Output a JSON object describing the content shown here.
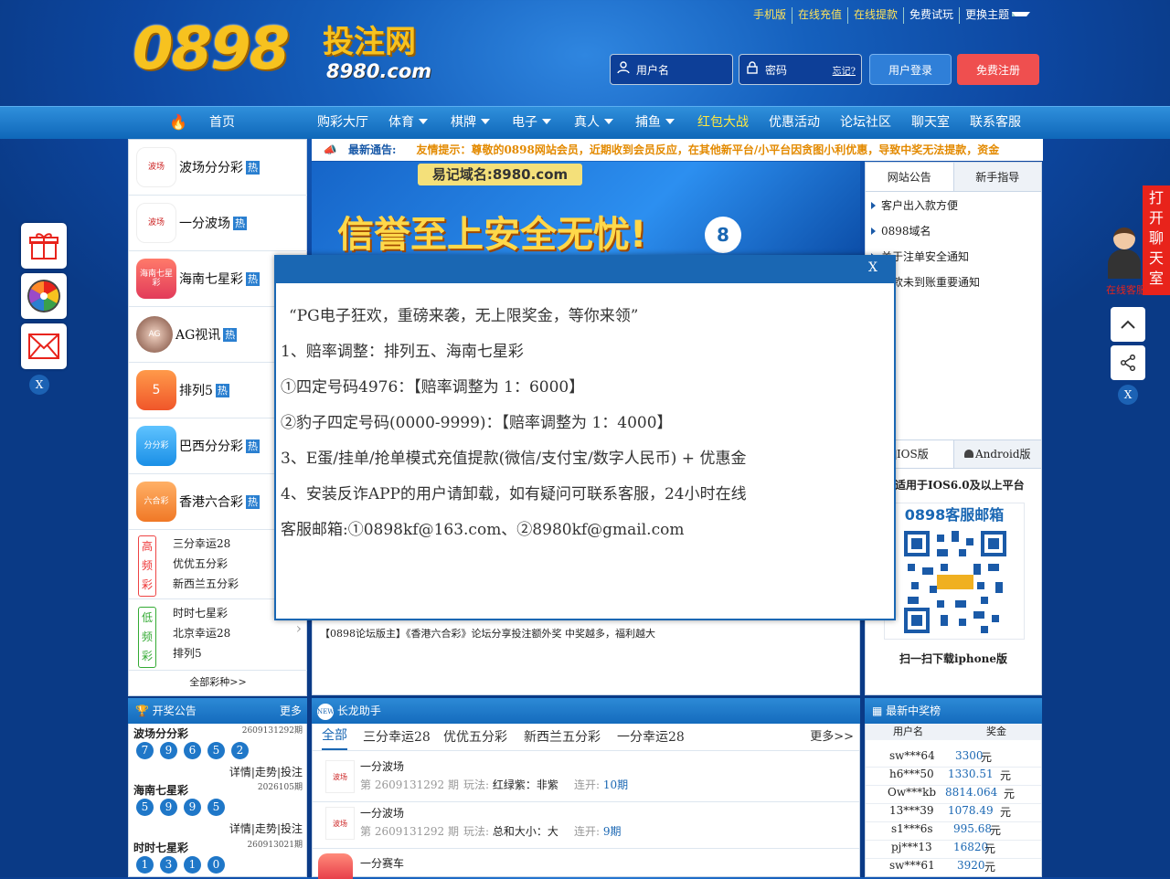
{
  "logo": {
    "main": "0898",
    "cn": "投注网",
    "domain": "8980.com"
  },
  "top_links": [
    "手机版",
    "在线充值",
    "在线提款",
    "免费试玩",
    "更换主题"
  ],
  "login": {
    "user_placeholder": "用户名",
    "pass_placeholder": "密码",
    "forgot": "忘记?",
    "login_btn": "用户登录",
    "register_btn": "免费注册"
  },
  "nav": {
    "home": "首页",
    "items": [
      "购彩大厅",
      "体育",
      "棋牌",
      "电子",
      "真人",
      "捕鱼",
      "红包大战",
      "优惠活动",
      "论坛社区",
      "聊天室",
      "联系客服"
    ]
  },
  "left_games": [
    {
      "name": "波场分分彩",
      "icon": "波场",
      "hot": "热"
    },
    {
      "name": "一分波场",
      "icon": "波场",
      "hot": "热"
    },
    {
      "name": "海南七星彩",
      "icon": "海南七星彩",
      "hot": "热"
    },
    {
      "name": "AG视讯",
      "icon": "AG",
      "hot": "热"
    },
    {
      "name": "排列5",
      "icon": "5",
      "hot": "热"
    },
    {
      "name": "巴西分分彩",
      "icon": "分分彩",
      "hot": "热"
    },
    {
      "name": "香港六合彩",
      "icon": "六合彩",
      "hot": "热"
    }
  ],
  "freq_high": {
    "tag": "高频彩",
    "items": [
      "三分幸运28",
      "优优五分彩",
      "新西兰五分彩"
    ]
  },
  "freq_low": {
    "tag": "低频彩",
    "items": [
      "时时七星彩",
      "北京幸运28",
      "排列5"
    ]
  },
  "all_games": "全部彩种>>",
  "notice": {
    "label": "最新通告:",
    "text": "友情提示：尊敬的0898网站会员，近期收到会员反应，在其他新平台/小平台因贪图小利优惠，导致中奖无法提款，资金"
  },
  "banner": {
    "domain": "易记域名:8980.com",
    "slogan": "信誉至上安全无忧!"
  },
  "right_tabs": [
    "网站公告",
    "新手指导"
  ],
  "right_list": [
    "客户出入款方便",
    "0898域名",
    "关于注单安全通知",
    "提款未到账重要通知"
  ],
  "app_tabs": [
    "IOS版",
    "Android版"
  ],
  "app_note": "适用于IOS6.0及以上平台",
  "qr_title": "0898客服邮箱",
  "qr_caption": "扫一扫下载iphone版",
  "forum_line": "【0898论坛版主】《香港六合彩》论坛分享投注额外奖 中奖越多，福利越大",
  "modal": {
    "close": "X",
    "lines": [
      "“PG电子狂欢，重磅来袭，无上限奖金，等你来领”",
      "1、赔率调整：排列五、海南七星彩",
      "①四定号码4976：【赔率调整为 1：6000】",
      "②豹子四定号码(0000-9999)：【赔率调整为 1：4000】",
      "3、E蛋/挂单/抢单模式充值提款(微信/支付宝/数字人民币) + 优惠金",
      "4、安装反诈APP的用户请卸载，如有疑问可联系客服，24小时在线",
      "客服邮箱:①0898kf@163.com、②8980kf@gmail.com"
    ]
  },
  "draws": {
    "title": "开奖公告",
    "more": "更多",
    "items": [
      {
        "name": "波场分分彩",
        "issue": "2609131292期",
        "balls": [
          "7",
          "9",
          "6",
          "5",
          "2"
        ],
        "links": "详情|走势|投注"
      },
      {
        "name": "海南七星彩",
        "issue": "2026105期",
        "balls": [
          "5",
          "9",
          "9",
          "5"
        ],
        "links": "详情|走势|投注"
      },
      {
        "name": "时时七星彩",
        "issue": "260913021期",
        "balls": [
          "1",
          "3",
          "1",
          "0"
        ],
        "links": ""
      }
    ]
  },
  "dragon": {
    "title": "长龙助手",
    "tabs": [
      "全部",
      "三分幸运28",
      "优优五分彩",
      "新西兰五分彩",
      "一分幸运28"
    ],
    "more": "更多>>",
    "rows": [
      {
        "game": "一分波场",
        "issue": "第 2609131292 期",
        "play_label": "玩法:",
        "play": "红绿紫：",
        "val": "非紫",
        "streak_label": "连开:",
        "streak": "10期"
      },
      {
        "game": "一分波场",
        "issue": "第 2609131292 期",
        "play_label": "玩法:",
        "play": "总和大小：",
        "val": "大",
        "streak_label": "连开:",
        "streak": "9期"
      },
      {
        "game": "一分赛车",
        "issue": "",
        "play_label": "",
        "play": "",
        "val": "",
        "streak_label": "",
        "streak": ""
      }
    ]
  },
  "winners": {
    "title": "最新中奖榜",
    "col_user": "用户名",
    "col_prize": "奖金",
    "rows": [
      {
        "user": "sw***64",
        "prize": "3300",
        "unit": "元"
      },
      {
        "user": "h6***50",
        "prize": "1330.51",
        "unit": "元"
      },
      {
        "user": "Ow***kb",
        "prize": "8814.064",
        "unit": "元"
      },
      {
        "user": "13***39",
        "prize": "1078.49",
        "unit": "元"
      },
      {
        "user": "s1***6s",
        "prize": "995.68",
        "unit": "元"
      },
      {
        "user": "pj***13",
        "prize": "16820",
        "unit": "元"
      },
      {
        "user": "sw***61",
        "prize": "3920",
        "unit": "元"
      }
    ]
  },
  "side": {
    "close": "X",
    "chat": "打开聊天室",
    "cs": "在线客服"
  },
  "colors": {
    "accent": "#1a67b3",
    "red": "#e8231b",
    "gold": "#f7c21f"
  }
}
